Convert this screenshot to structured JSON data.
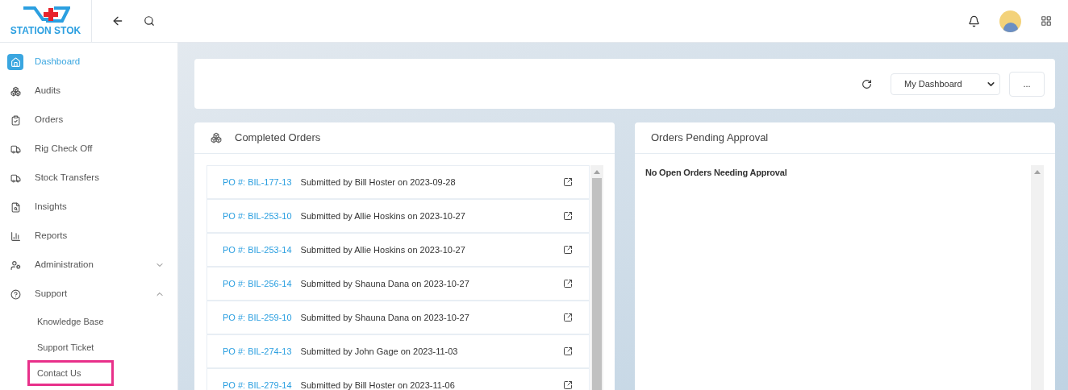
{
  "logo": {
    "text": "STATION STOK"
  },
  "sidebar": {
    "items": [
      {
        "label": "Dashboard",
        "selected": true
      },
      {
        "label": "Audits",
        "selected": false
      },
      {
        "label": "Orders",
        "selected": false
      },
      {
        "label": "Rig Check Off",
        "selected": false
      },
      {
        "label": "Stock Transfers",
        "selected": false
      },
      {
        "label": "Insights",
        "selected": false
      },
      {
        "label": "Reports",
        "selected": false
      },
      {
        "label": "Administration",
        "selected": false,
        "expanded": false
      },
      {
        "label": "Support",
        "selected": false,
        "expanded": true,
        "children": [
          {
            "label": "Knowledge Base",
            "highlighted": false
          },
          {
            "label": "Support Ticket",
            "highlighted": false
          },
          {
            "label": "Contact Us",
            "highlighted": true
          }
        ]
      }
    ]
  },
  "toolbar": {
    "dashboard_select": {
      "value": "My Dashboard"
    },
    "more_button": "..."
  },
  "completed_orders": {
    "title": "Completed Orders",
    "rows": [
      {
        "po": "PO #: BIL-177-13",
        "text": "Submitted by Bill Hoster on 2023-09-28"
      },
      {
        "po": "PO #: BIL-253-10",
        "text": "Submitted by Allie Hoskins on 2023-10-27"
      },
      {
        "po": "PO #: BIL-253-14",
        "text": "Submitted by Allie Hoskins on 2023-10-27"
      },
      {
        "po": "PO #: BIL-256-14",
        "text": "Submitted by Shauna Dana on 2023-10-27"
      },
      {
        "po": "PO #: BIL-259-10",
        "text": "Submitted by Shauna Dana on 2023-10-27"
      },
      {
        "po": "PO #: BIL-274-13",
        "text": "Submitted by John Gage on 2023-11-03"
      },
      {
        "po": "PO #: BIL-279-14",
        "text": "Submitted by Bill Hoster on 2023-11-06"
      }
    ]
  },
  "pending_orders": {
    "title": "Orders Pending Approval",
    "message": "No Open Orders Needing Approval"
  }
}
